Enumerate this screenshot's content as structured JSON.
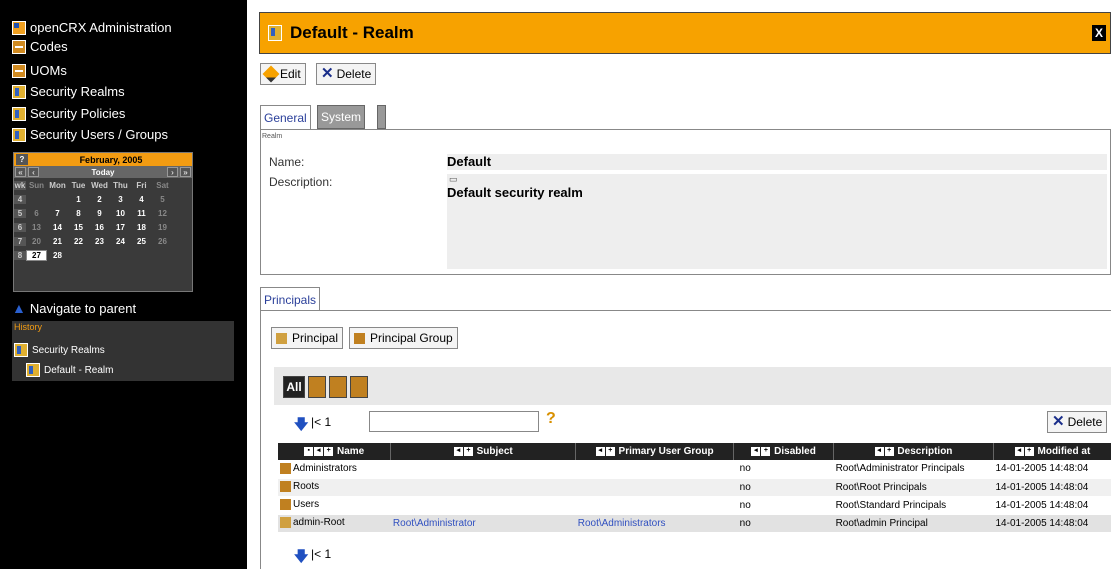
{
  "sidebar": {
    "items": [
      {
        "label": "openCRX Administration",
        "icon": "admin-icon"
      },
      {
        "label": "Codes",
        "icon": "codes-icon"
      },
      {
        "label": "UOMs",
        "icon": "uoms-icon"
      },
      {
        "label": "Security Realms",
        "icon": "realm-icon"
      },
      {
        "label": "Security Policies",
        "icon": "policy-icon"
      },
      {
        "label": "Security Users / Groups",
        "icon": "users-groups-icon"
      }
    ],
    "navigate_parent": "Navigate to parent",
    "history": {
      "label": "History",
      "items": [
        "Security Realms",
        "Default - Realm"
      ]
    }
  },
  "calendar": {
    "help": "?",
    "month": "February, 2005",
    "today": "Today",
    "prev_year": "«",
    "prev_month": "‹",
    "next_month": "›",
    "next_year": "»",
    "weekday_header": [
      "wk",
      "Sun",
      "Mon",
      "Tue",
      "Wed",
      "Thu",
      "Fri",
      "Sat"
    ],
    "weeks": [
      [
        "4",
        "",
        "",
        "1",
        "2",
        "3",
        "4",
        "5"
      ],
      [
        "5",
        "6",
        "7",
        "8",
        "9",
        "10",
        "11",
        "12"
      ],
      [
        "6",
        "13",
        "14",
        "15",
        "16",
        "17",
        "18",
        "19"
      ],
      [
        "7",
        "20",
        "21",
        "22",
        "23",
        "24",
        "25",
        "26"
      ],
      [
        "8",
        "27",
        "28",
        "",
        "",
        "",
        "",
        ""
      ]
    ],
    "selected_day": "27"
  },
  "header": {
    "title": "Default - Realm",
    "close": "X"
  },
  "toolbar": {
    "edit_label": "Edit",
    "delete_label": "Delete"
  },
  "tabs": {
    "general": "General",
    "system": "System"
  },
  "realm_section": {
    "section_label": "Realm",
    "name_label": "Name:",
    "name_value": "Default",
    "description_label": "Description:",
    "description_value": "Default security realm"
  },
  "principals": {
    "tab_label": "Principals",
    "add_principal": "Principal",
    "add_principal_group": "Principal Group",
    "filter_all": "All",
    "pager_text": "|< 1",
    "search_placeholder": "",
    "help": "?",
    "delete_label": "Delete",
    "columns": [
      "Name",
      "Subject",
      "Primary User Group",
      "Disabled",
      "Description",
      "Modified at"
    ],
    "rows": [
      {
        "name": "Administrators",
        "subject": "",
        "primary_group": "",
        "disabled": "no",
        "description": "Root\\Administrator Principals",
        "modified": "14-01-2005 14:48:04",
        "type": "group"
      },
      {
        "name": "Roots",
        "subject": "",
        "primary_group": "",
        "disabled": "no",
        "description": "Root\\Root Principals",
        "modified": "14-01-2005 14:48:04",
        "type": "group"
      },
      {
        "name": "Users",
        "subject": "",
        "primary_group": "",
        "disabled": "no",
        "description": "Root\\Standard Principals",
        "modified": "14-01-2005 14:48:04",
        "type": "group"
      },
      {
        "name": "admin-Root",
        "subject": "Root\\Administrator",
        "primary_group": "Root\\Administrators",
        "disabled": "no",
        "description": "Root\\admin Principal",
        "modified": "14-01-2005 14:48:04",
        "type": "user"
      }
    ],
    "bottom_pager": "|< 1"
  },
  "colors": {
    "accent": "#f7a200",
    "sidebar_bg": "#000000",
    "link": "#3050c0"
  }
}
